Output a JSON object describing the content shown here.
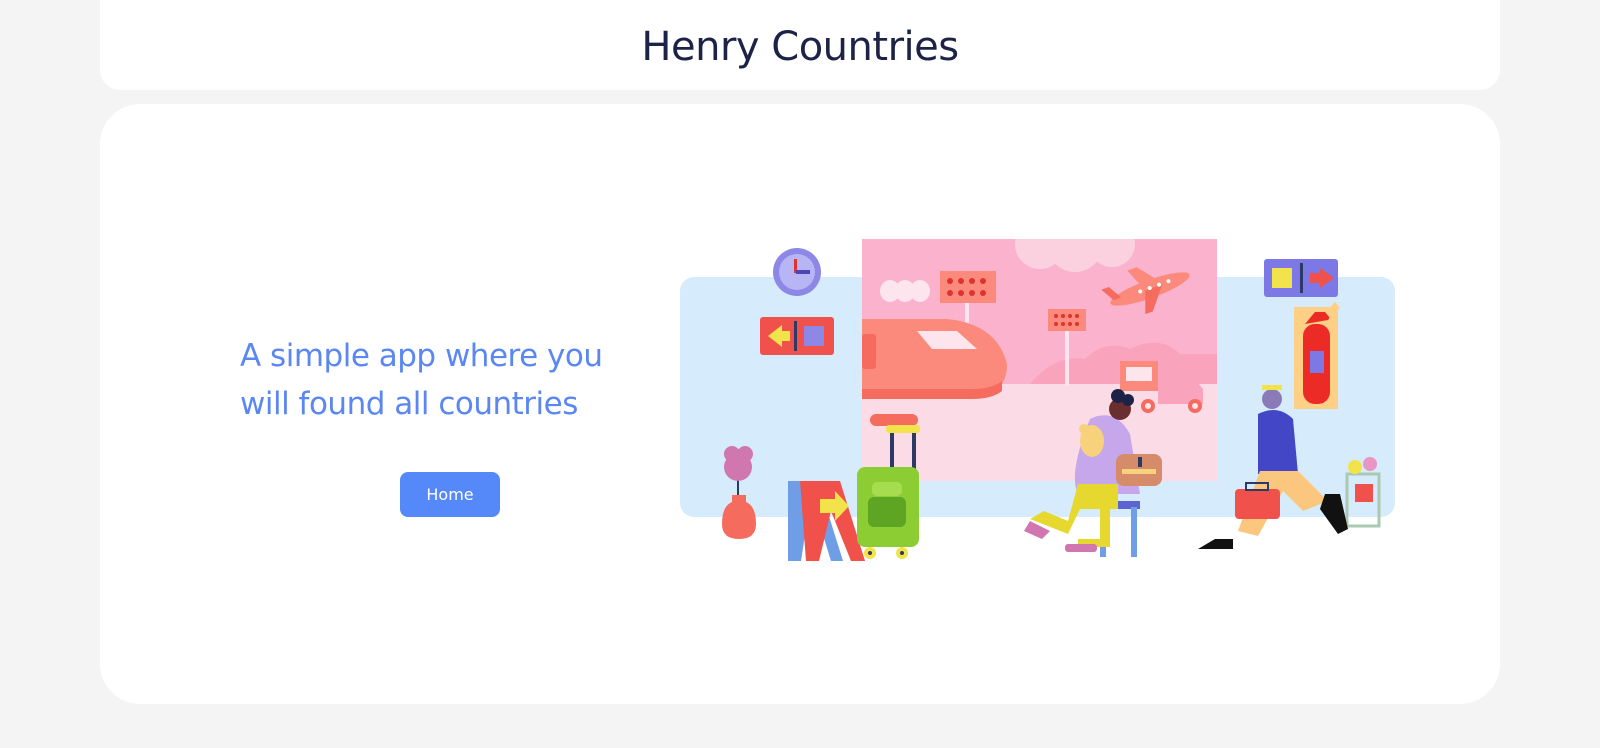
{
  "header": {
    "title": "Henry Countries"
  },
  "hero": {
    "tagline_line1": "A simple app where you",
    "tagline_line2": "will found all countries",
    "button_label": "Home"
  },
  "illustration": {
    "subject": "airport-travelers-illustration"
  },
  "colors": {
    "page_background": "#f4f4f4",
    "card_background": "#ffffff",
    "title": "#1d2347",
    "accent": "#5b87f2",
    "button": "#5588f8"
  }
}
